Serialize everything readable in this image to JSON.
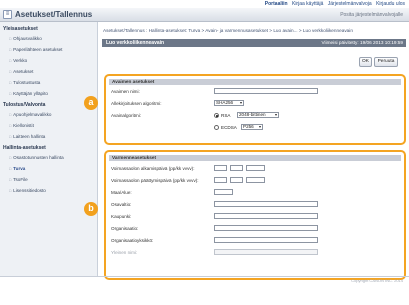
{
  "toplinks": [
    "Portaaliin",
    "Kirjaa käyttäjä",
    "Järjestelmänvalvoja",
    "Kirjaudu ulos"
  ],
  "header": {
    "title": "Asetukset/Tallennus",
    "right": "Posita järjestelmänvalvojalle"
  },
  "sidebar": {
    "groups": [
      {
        "title": "Yleisasetukset",
        "items": [
          "Ohjausvalikko",
          "Paperilähteen asetukset",
          "Verkko",
          "Asetukset",
          "Tulostustusta",
          "Käyttäjän ylläpito"
        ]
      },
      {
        "title": "Tulostus/Valvonta",
        "items": [
          "Apuohjelmavalikko",
          "Kiellonistit",
          "Laitteen hallinta"
        ]
      },
      {
        "title": "Hallinta-asetukset",
        "items": [
          "Osastotunnusten hallinta",
          "Turva",
          "TsoFile",
          "Lisenssitiedosto"
        ]
      }
    ]
  },
  "main": {
    "breadcrumb": "Asetukset/Tallennus : Hallinta-asetukset: Turva > Avain- ja varmennusasetukset > Luo avain... > Luo verkkoliikenneavain",
    "title": "Luo verkkoliikenneavain",
    "updated": "Viimeisi päivitetty: 19/06 2013 10:19:59",
    "ok_label": "OK",
    "cancel_label": "Peruuta",
    "key_section": {
      "header": "Avaimen asetukset",
      "name_label": "Avaimen nimi:",
      "algo_label": "Allekirjoituksen algoritmi:",
      "algo_value": "SHA256",
      "keyalgo_label": "Avainalgoritmi:",
      "rsa_label": "RSA",
      "rsa_value": "2048-bittinen",
      "ecdsa_label": "ECDSA",
      "ecdsa_value": "P256"
    },
    "cert_section": {
      "header": "Varmenneasetukset",
      "rows": [
        "Voimassaolon alkamispäivä (pp/kk vvvv):",
        "Voimassaolon päättymispäivä (pp/kk vvvv):",
        "Maa/Alue:",
        "Osavaltio:",
        "Kaupunki:",
        "Organisaatio:",
        "Organisaatioyksikkö:",
        "Yleinen nimi:"
      ]
    },
    "badges": [
      "a",
      "b"
    ]
  },
  "copyright": "Copyright CANON INC. 2014"
}
